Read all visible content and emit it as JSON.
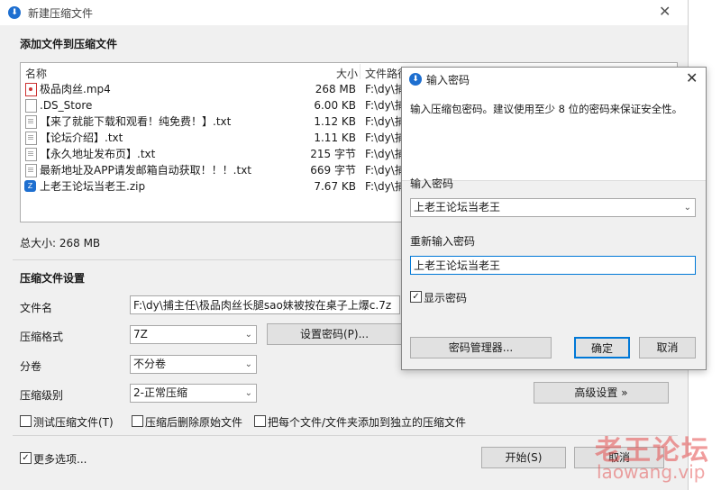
{
  "main": {
    "title": "新建压缩文件",
    "heading": "添加文件到压缩文件",
    "columns": {
      "name": "名称",
      "size": "大小",
      "path": "文件路径"
    },
    "files": [
      {
        "name": "极品肉丝.mp4",
        "size": "268 MB",
        "path": "F:\\dy\\捕",
        "icon": "mp4-file-icon"
      },
      {
        "name": ".DS_Store",
        "size": "6.00 KB",
        "path": "F:\\dy\\捕",
        "icon": "blank-file-icon"
      },
      {
        "name": "【来了就能下载和观看！纯免费！】.txt",
        "size": "1.12 KB",
        "path": "F:\\dy\\捕",
        "icon": "text-file-icon"
      },
      {
        "name": "【论坛介绍】.txt",
        "size": "1.11 KB",
        "path": "F:\\dy\\捕",
        "icon": "text-file-icon"
      },
      {
        "name": "【永久地址发布页】.txt",
        "size": "215 字节",
        "path": "F:\\dy\\捕",
        "icon": "text-file-icon"
      },
      {
        "name": "最新地址及APP请发邮箱自动获取！！！.txt",
        "size": "669 字节",
        "path": "F:\\dy\\捕",
        "icon": "text-file-icon"
      },
      {
        "name": "上老王论坛当老王.zip",
        "size": "7.67 KB",
        "path": "F:\\dy\\捕",
        "icon": "zip-file-icon"
      }
    ],
    "total_size": "总大小: 268 MB",
    "settings_heading": "压缩文件设置",
    "filename_label": "文件名",
    "filename_value": "F:\\dy\\捕主任\\极品肉丝长腿sao妹被按在桌子上爆c.7z",
    "format_label": "压缩格式",
    "format_value": "7Z",
    "set_password_button": "设置密码(P)...",
    "volume_label": "分卷",
    "volume_value": "不分卷",
    "level_label": "压缩级别",
    "level_value": "2-正常压缩",
    "advanced_button": "高级设置 »",
    "test_archive": "测试压缩文件(T)",
    "delete_after": "压缩后删除原始文件",
    "separate_archives": "把每个文件/文件夹添加到独立的压缩文件",
    "more_options": "更多选项...",
    "start_button": "开始(S)",
    "cancel_button": "取消"
  },
  "dialog": {
    "title": "输入密码",
    "instruction": "输入压缩包密码。建议使用至少 8 位的密码来保证安全性。",
    "password_label": "输入密码",
    "password_value": "上老王论坛当老王",
    "confirm_label": "重新输入密码",
    "confirm_value": "上老王论坛当老王",
    "show_password": "显示密码",
    "manager_button": "密码管理器...",
    "ok_button": "确定",
    "cancel_button": "取消"
  },
  "watermark": {
    "line1": "老王论坛",
    "line2": "laowang.vip"
  },
  "colors": {
    "accent": "#0078d7",
    "app_icon": "#1e6fd0",
    "watermark": "#e44d4d"
  }
}
